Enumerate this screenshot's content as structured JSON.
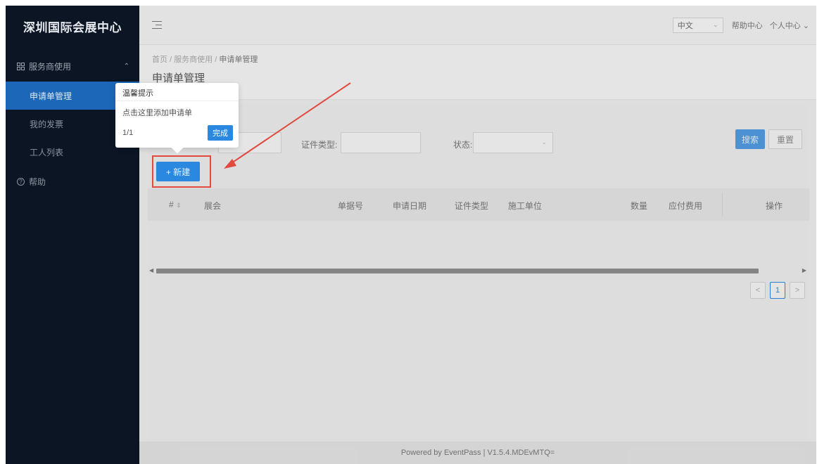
{
  "sidebar": {
    "brand": "深圳国际会展中心",
    "group_label": "服务商使用",
    "items": [
      {
        "label": "申请单管理",
        "active": true
      },
      {
        "label": "我的发票",
        "active": false
      },
      {
        "label": "工人列表",
        "active": false
      }
    ],
    "help_label": "帮助"
  },
  "topbar": {
    "language_value": "中文",
    "help_center": "帮助中心",
    "personal_center": "个人中心"
  },
  "breadcrumb": {
    "home": "首页",
    "section": "服务商使用",
    "current": "申请单管理"
  },
  "page_title": "申请单管理",
  "filters": {
    "cert_type_label": "证件类型:",
    "status_label": "状态:",
    "search_button": "搜索",
    "reset_button": "重置"
  },
  "new_button": "+ 新建",
  "table": {
    "columns": [
      "#",
      "展会",
      "单据号",
      "申请日期",
      "证件类型",
      "施工单位",
      "数量",
      "应付费用",
      "操作"
    ]
  },
  "pagination": {
    "current_page": "1",
    "prev": "<",
    "next": ">"
  },
  "footer": "Powered by EventPass | V1.5.4.MDEvMTQ=",
  "guide": {
    "title": "温馨提示",
    "message": "点击这里添加申请单",
    "step": "1/1",
    "done_button": "完成"
  },
  "colors": {
    "sidebar_bg": "#0b1524",
    "primary": "#2a88e0",
    "highlight": "#e04a3f"
  }
}
